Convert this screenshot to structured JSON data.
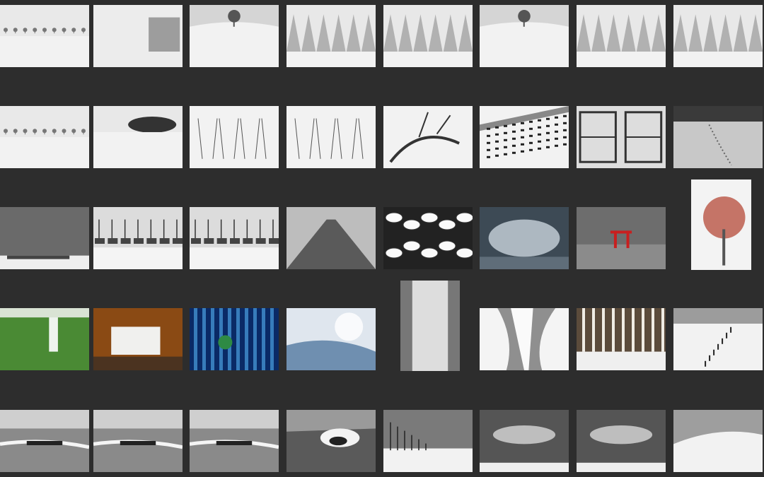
{
  "gallery": {
    "title": "",
    "rows": [
      [
        {
          "id": "r1c1",
          "subject": "tree-row-in-snow",
          "tone": "mono"
        },
        {
          "id": "r1c2",
          "subject": "forest-grove-in-snow",
          "tone": "mono"
        },
        {
          "id": "r1c3",
          "subject": "lone-tree-on-hill",
          "tone": "mono"
        },
        {
          "id": "r1c4",
          "subject": "snow-covered-trees",
          "tone": "mono"
        },
        {
          "id": "r1c5",
          "subject": "snowy-conifers",
          "tone": "mono"
        },
        {
          "id": "r1c6",
          "subject": "lone-tree-snowfield",
          "tone": "mono"
        },
        {
          "id": "r1c7",
          "subject": "frosted-forest",
          "tone": "mono"
        },
        {
          "id": "r1c8",
          "subject": "snow-stream-woods",
          "tone": "mono"
        }
      ],
      [
        {
          "id": "r2c1",
          "subject": "tree-row-fog",
          "tone": "mono"
        },
        {
          "id": "r2c2",
          "subject": "tree-cluster-snowfield",
          "tone": "mono"
        },
        {
          "id": "r2c3",
          "subject": "bare-twigs-snow",
          "tone": "mono"
        },
        {
          "id": "r2c4",
          "subject": "reeds-in-snow",
          "tone": "mono"
        },
        {
          "id": "r2c5",
          "subject": "fallen-branch",
          "tone": "mono"
        },
        {
          "id": "r2c6",
          "subject": "fence-posts-slope",
          "tone": "mono"
        },
        {
          "id": "r2c7",
          "subject": "wooden-pier-structure",
          "tone": "mono"
        },
        {
          "id": "r2c8",
          "subject": "footprints-coast",
          "tone": "mono"
        }
      ],
      [
        {
          "id": "r3c1",
          "subject": "misty-shore",
          "tone": "mono"
        },
        {
          "id": "r3c2",
          "subject": "fishing-boats-snow",
          "tone": "mono"
        },
        {
          "id": "r3c3",
          "subject": "boats-in-harbor",
          "tone": "mono"
        },
        {
          "id": "r3c4",
          "subject": "stone-jetty",
          "tone": "mono"
        },
        {
          "id": "r3c5",
          "subject": "snow-capped-rocks-stream",
          "tone": "mono"
        },
        {
          "id": "r3c6",
          "subject": "stormy-sky-sea",
          "tone": "blue"
        },
        {
          "id": "r3c7",
          "subject": "torii-gate-sea",
          "tone": "red-accent"
        },
        {
          "id": "r3c8",
          "subject": "red-berry-tree",
          "tone": "red-accent"
        }
      ],
      [
        {
          "id": "r4c1",
          "subject": "green-waterfall",
          "tone": "green"
        },
        {
          "id": "r4c2",
          "subject": "autumn-waterfall",
          "tone": "autumn"
        },
        {
          "id": "r4c3",
          "subject": "blue-waterfall",
          "tone": "blue"
        },
        {
          "id": "r4c4",
          "subject": "icy-blue-stream",
          "tone": "blue"
        },
        {
          "id": "r4c5",
          "subject": "waterfall-close-up",
          "tone": "mono"
        },
        {
          "id": "r4c6",
          "subject": "frozen-cascade",
          "tone": "mono"
        },
        {
          "id": "r4c7",
          "subject": "birch-trunks",
          "tone": "sepia"
        },
        {
          "id": "r4c8",
          "subject": "snow-fence-line",
          "tone": "mono"
        }
      ],
      [
        {
          "id": "r5c1",
          "subject": "rocky-coast-waves",
          "tone": "mono"
        },
        {
          "id": "r5c2",
          "subject": "surf-rocks",
          "tone": "mono"
        },
        {
          "id": "r5c3",
          "subject": "breakwater-sea",
          "tone": "mono"
        },
        {
          "id": "r5c4",
          "subject": "crashing-wave-rock",
          "tone": "mono"
        },
        {
          "id": "r5c5",
          "subject": "utility-poles-snow",
          "tone": "mono"
        },
        {
          "id": "r5c6",
          "subject": "sun-rays-clouds",
          "tone": "mono"
        },
        {
          "id": "r5c7",
          "subject": "cloudy-horizon",
          "tone": "mono"
        },
        {
          "id": "r5c8",
          "subject": "snow-dune",
          "tone": "mono"
        }
      ]
    ]
  }
}
